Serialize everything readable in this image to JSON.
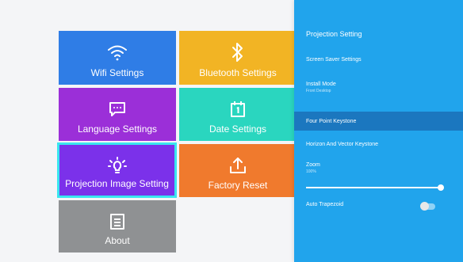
{
  "tiles": {
    "wifi": {
      "label": "Wifi Settings",
      "icon": "wifi-icon",
      "color": "#2f7de6"
    },
    "bluetooth": {
      "label": "Bluetooth Settings",
      "icon": "bluetooth-icon",
      "color": "#f2b424"
    },
    "language": {
      "label": "Language Settings",
      "icon": "chat-icon",
      "color": "#9b2fd8"
    },
    "date": {
      "label": "Date Settings",
      "icon": "calendar-icon",
      "color": "#2ad6bf"
    },
    "projection": {
      "label": "Projection Image Setting",
      "icon": "lightbulb-icon",
      "color": "#7b31ea",
      "selected": true
    },
    "factory_reset": {
      "label": "Factory Reset",
      "icon": "upload-icon",
      "color": "#f07a2d"
    },
    "about": {
      "label": "About",
      "icon": "info-box-icon",
      "color": "#8f9193"
    }
  },
  "panel": {
    "title": "Projection Setting",
    "screen_saver": "Screen Saver Settings",
    "install_mode": {
      "label": "Install Mode",
      "value": "Front Desktop"
    },
    "four_point": "Four Point Keystone",
    "horizon_vector": "Horizon And Vector Keystone",
    "zoom": {
      "label": "Zoom",
      "value": "100%",
      "level": 1.0
    },
    "auto_trapezoid": {
      "label": "Auto Trapezoid",
      "enabled": false
    }
  },
  "colors": {
    "panel": "#21a4ec",
    "highlight": "#1b77bf",
    "focus_border": "#39e6ef"
  }
}
